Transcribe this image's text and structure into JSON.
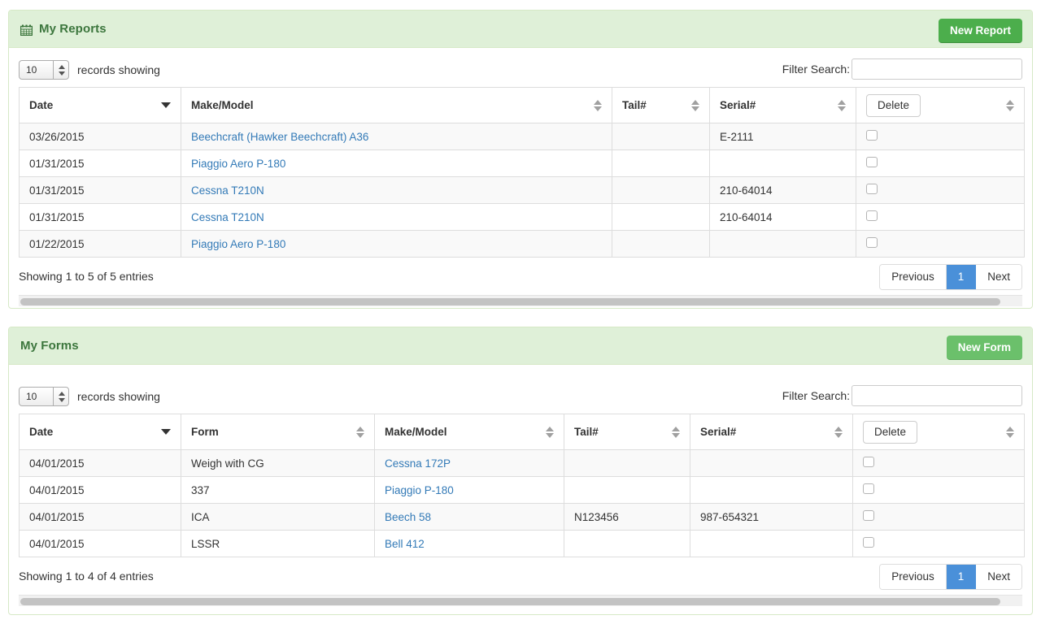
{
  "reports_panel": {
    "title": "My Reports",
    "icon": "calendar-icon",
    "new_button": "New Report",
    "length_value": "10",
    "length_suffix": "records showing",
    "filter_label": "Filter Search:",
    "filter_value": "",
    "filter_placeholder": "",
    "columns": [
      {
        "label": "Date",
        "sort": "desc"
      },
      {
        "label": "Make/Model",
        "sort": "both"
      },
      {
        "label": "Tail#",
        "sort": "both"
      },
      {
        "label": "Serial#",
        "sort": "both"
      },
      {
        "label": "Delete",
        "sort": "both"
      }
    ],
    "rows": [
      {
        "date": "03/26/2015",
        "model": "Beechcraft (Hawker Beechcraft) A36",
        "tail": "",
        "serial": "E-2111",
        "checked": false
      },
      {
        "date": "01/31/2015",
        "model": "Piaggio Aero P-180",
        "tail": "",
        "serial": "",
        "checked": false
      },
      {
        "date": "01/31/2015",
        "model": "Cessna T210N",
        "tail": "",
        "serial": "210-64014",
        "checked": false
      },
      {
        "date": "01/31/2015",
        "model": "Cessna T210N",
        "tail": "",
        "serial": "210-64014",
        "checked": false
      },
      {
        "date": "01/22/2015",
        "model": "Piaggio Aero P-180",
        "tail": "",
        "serial": "",
        "checked": false
      }
    ],
    "info": "Showing 1 to 5 of 5 entries",
    "pager": {
      "previous": "Previous",
      "page": "1",
      "next": "Next"
    }
  },
  "forms_panel": {
    "title": "My Forms",
    "new_button": "New Form",
    "length_value": "10",
    "length_suffix": "records showing",
    "filter_label": "Filter Search:",
    "filter_value": "",
    "filter_placeholder": "",
    "columns": [
      {
        "label": "Date",
        "sort": "desc"
      },
      {
        "label": "Form",
        "sort": "both"
      },
      {
        "label": "Make/Model",
        "sort": "both"
      },
      {
        "label": "Tail#",
        "sort": "both"
      },
      {
        "label": "Serial#",
        "sort": "both"
      },
      {
        "label": "Delete",
        "sort": "both"
      }
    ],
    "rows": [
      {
        "date": "04/01/2015",
        "form": "Weigh with CG",
        "model": "Cessna 172P",
        "tail": "",
        "serial": "",
        "checked": false
      },
      {
        "date": "04/01/2015",
        "form": "337",
        "model": "Piaggio P-180",
        "tail": "",
        "serial": "",
        "checked": false
      },
      {
        "date": "04/01/2015",
        "form": "ICA",
        "model": "Beech 58",
        "tail": "N123456",
        "serial": "987-654321",
        "checked": false
      },
      {
        "date": "04/01/2015",
        "form": "LSSR",
        "model": "Bell 412",
        "tail": "",
        "serial": "",
        "checked": false
      }
    ],
    "info": "Showing 1 to 4 of 4 entries",
    "pager": {
      "previous": "Previous",
      "page": "1",
      "next": "Next"
    }
  },
  "colors": {
    "panel_header_bg": "#dff0d8",
    "panel_border": "#d6e9c6",
    "title_green": "#3c763d",
    "button_green_dark": "#4cae4c",
    "button_green_light": "#6bc06b",
    "link_blue": "#337ab7",
    "pager_active_blue": "#4a90d9"
  }
}
